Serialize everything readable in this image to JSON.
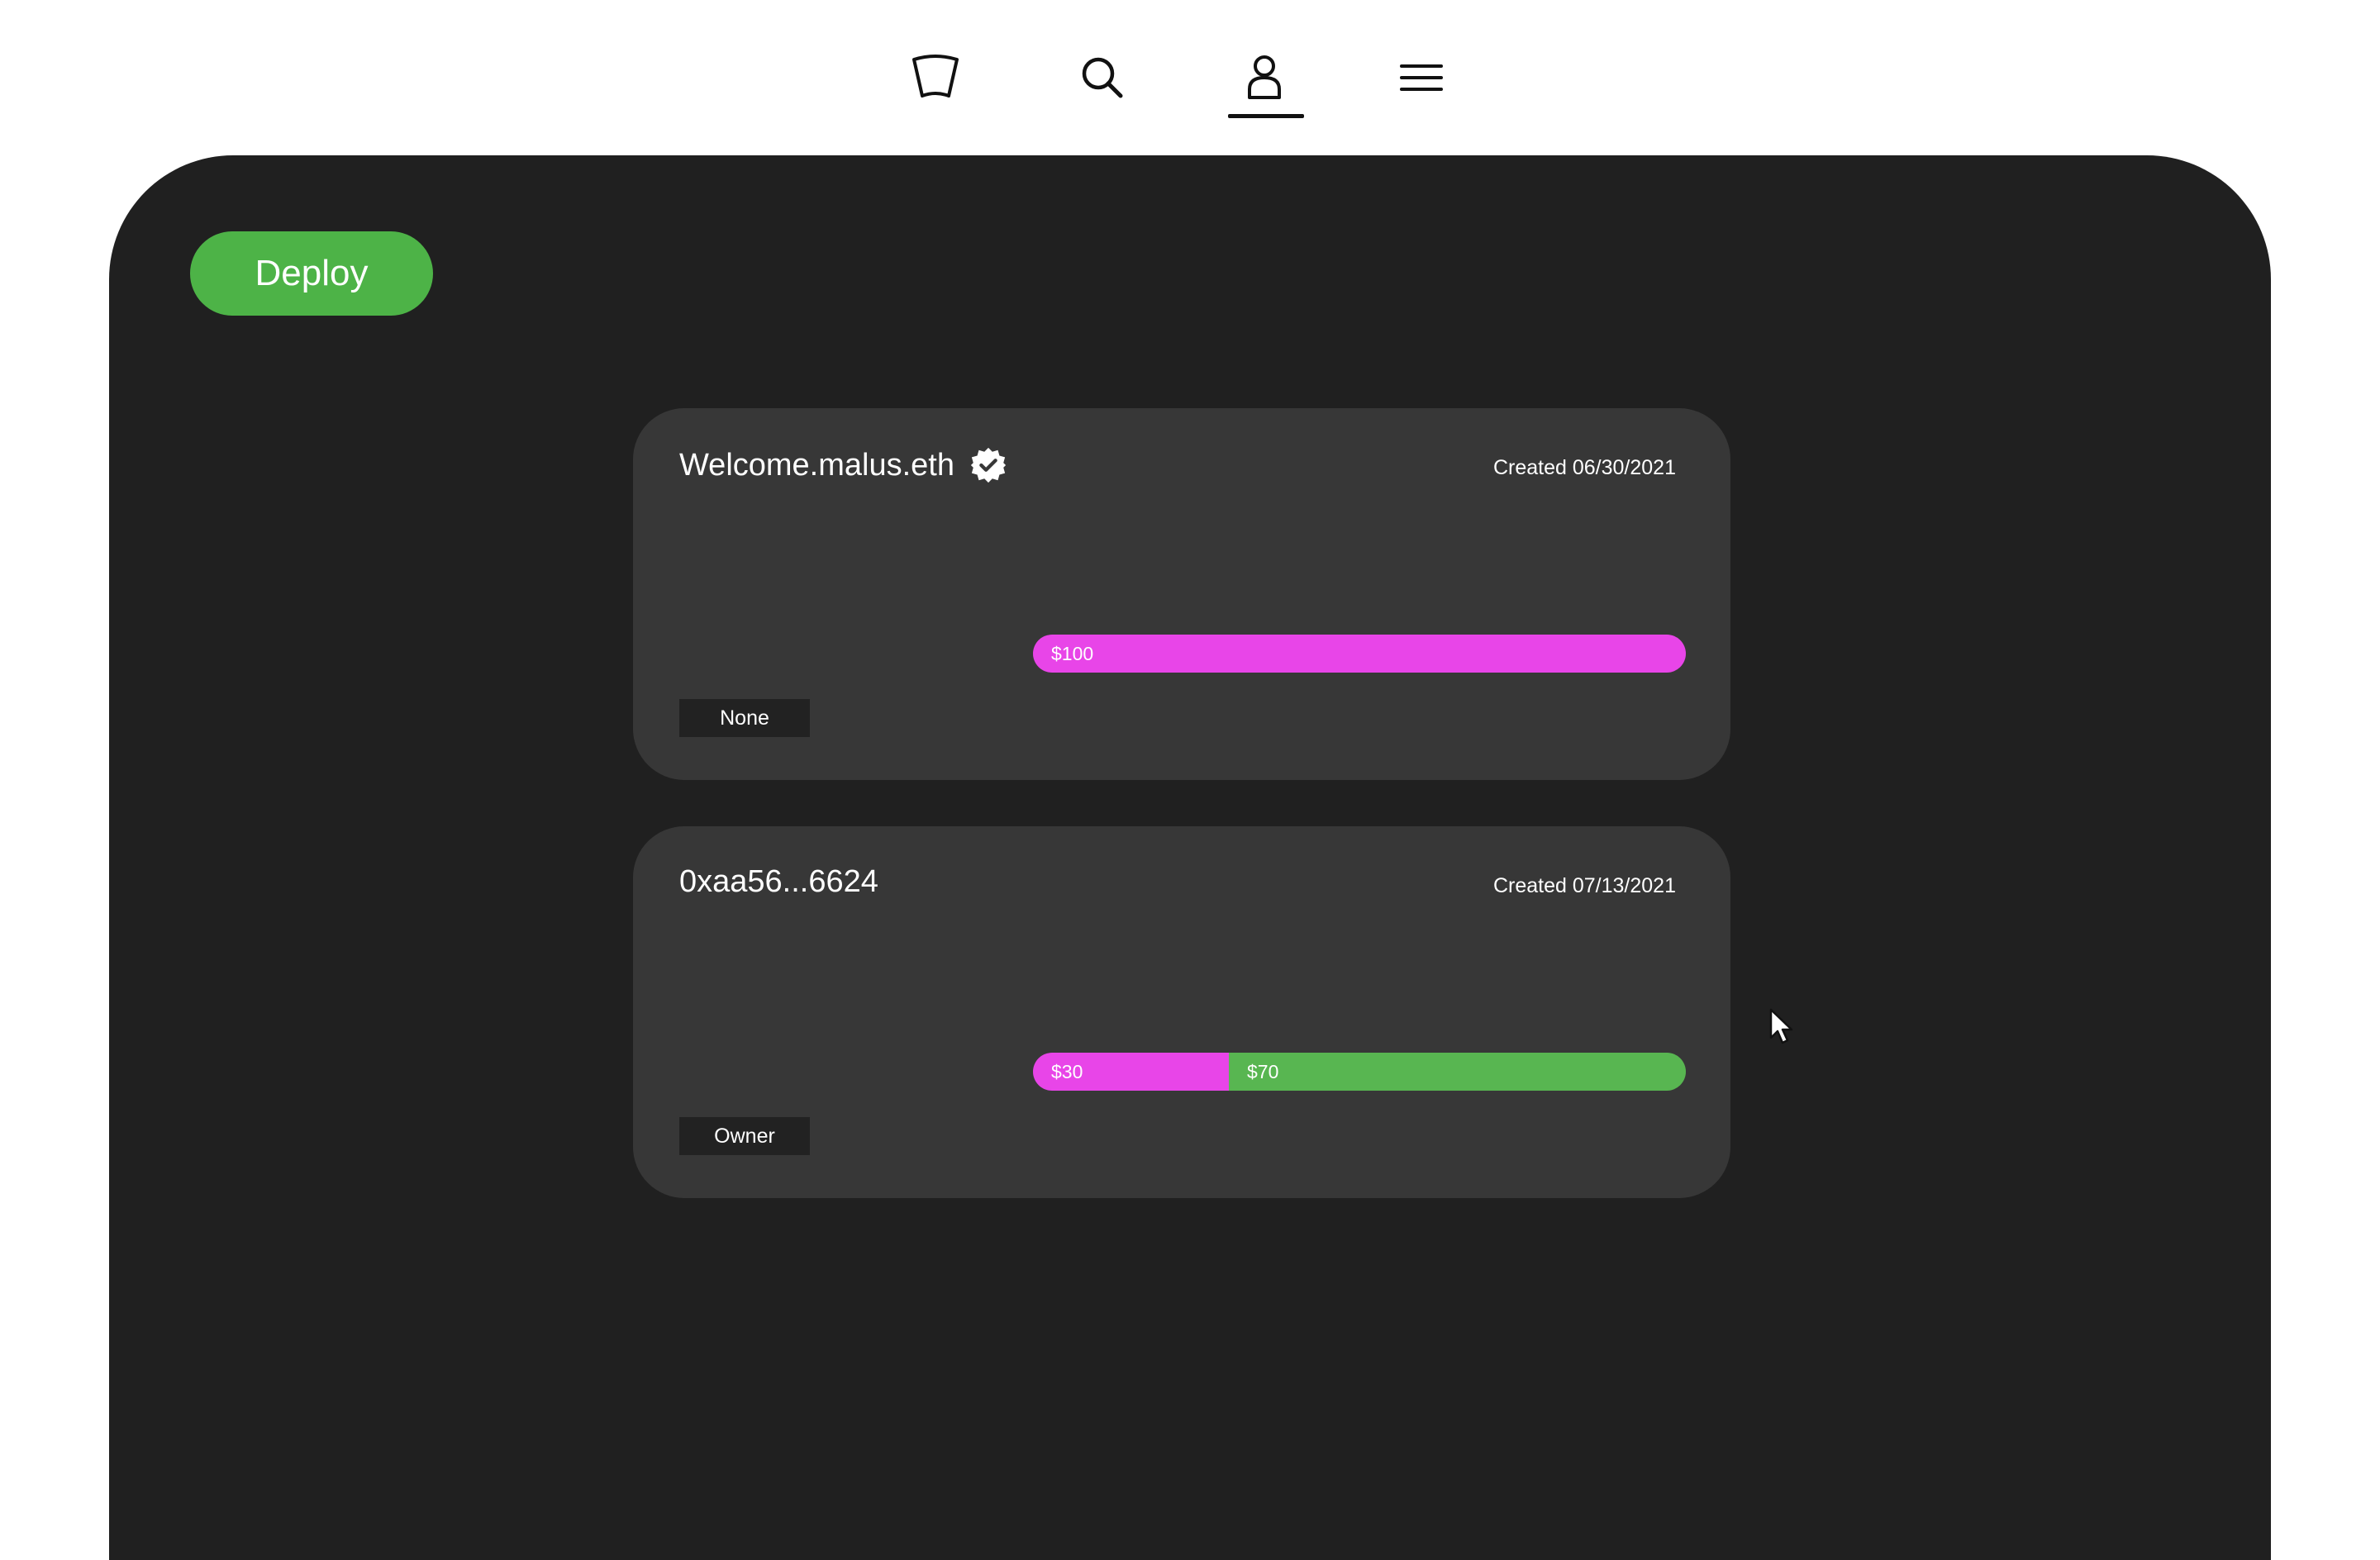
{
  "nav": {
    "items": [
      {
        "icon": "shield-icon"
      },
      {
        "icon": "search-icon"
      },
      {
        "icon": "user-icon",
        "active": true
      },
      {
        "icon": "menu-icon"
      }
    ]
  },
  "deploy": {
    "label": "Deploy"
  },
  "colors": {
    "accent_green": "#4db347",
    "accent_magenta": "#e845e8",
    "panel": "#202020",
    "card": "#373737"
  },
  "cards": [
    {
      "title": "Welcome.malus.eth",
      "verified": true,
      "created": "Created 06/30/2021",
      "bar": [
        {
          "label": "$100",
          "value": 100,
          "color": "#e845e8"
        }
      ],
      "role": "None"
    },
    {
      "title": "0xaa56...6624",
      "verified": false,
      "created": "Created 07/13/2021",
      "bar": [
        {
          "label": "$30",
          "value": 30,
          "color": "#e845e8"
        },
        {
          "label": "$70",
          "value": 70,
          "color": "#58b651"
        }
      ],
      "role": "Owner"
    }
  ]
}
